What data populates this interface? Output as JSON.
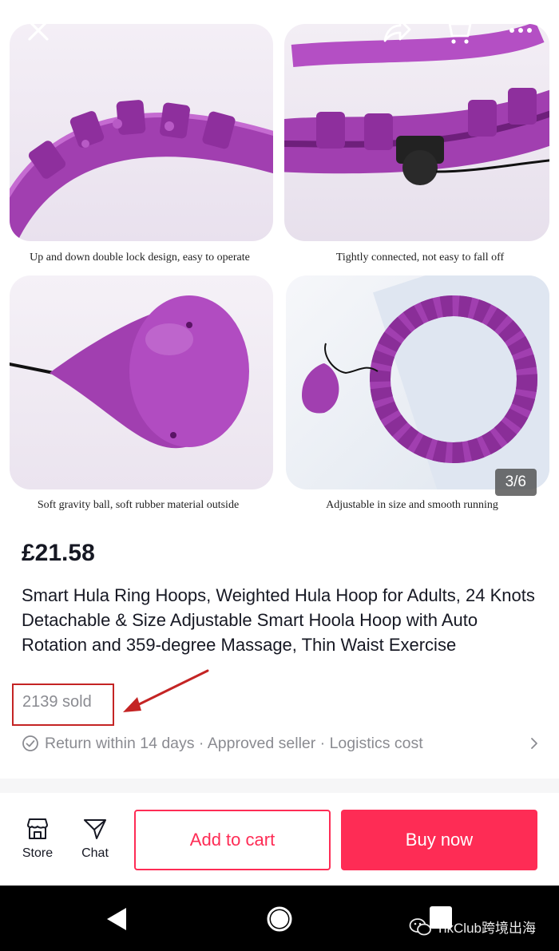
{
  "gallery": {
    "captions": [
      "Up and down double lock design, easy to operate",
      "Tightly connected, not easy to fall off",
      "Soft gravity ball, soft rubber material outside",
      "Adjustable in size and smooth running"
    ],
    "counter": "3/6"
  },
  "icons": {
    "close": "close-icon",
    "share": "share-icon",
    "cart": "cart-icon",
    "more": "more-icon"
  },
  "product": {
    "price": "£21.58",
    "title": "Smart Hula Ring Hoops, Weighted Hula Hoop for Adults, 24 Knots Detachable & Size Adjustable Smart Hoola Hoop with Auto Rotation and 359-degree Massage, Thin Waist Exercise",
    "sold": "2139 sold",
    "policy": "Return within 14 days · Approved seller · Logistics cost"
  },
  "actions": {
    "store_label": "Store",
    "chat_label": "Chat",
    "add_to_cart_label": "Add to cart",
    "buy_now_label": "Buy now"
  },
  "watermark": "TikClub跨境出海",
  "colors": {
    "accent": "#fe2c55",
    "product_purple": "#a13fb0",
    "annotation_red": "#c42424",
    "muted_text": "#8a8b91"
  }
}
